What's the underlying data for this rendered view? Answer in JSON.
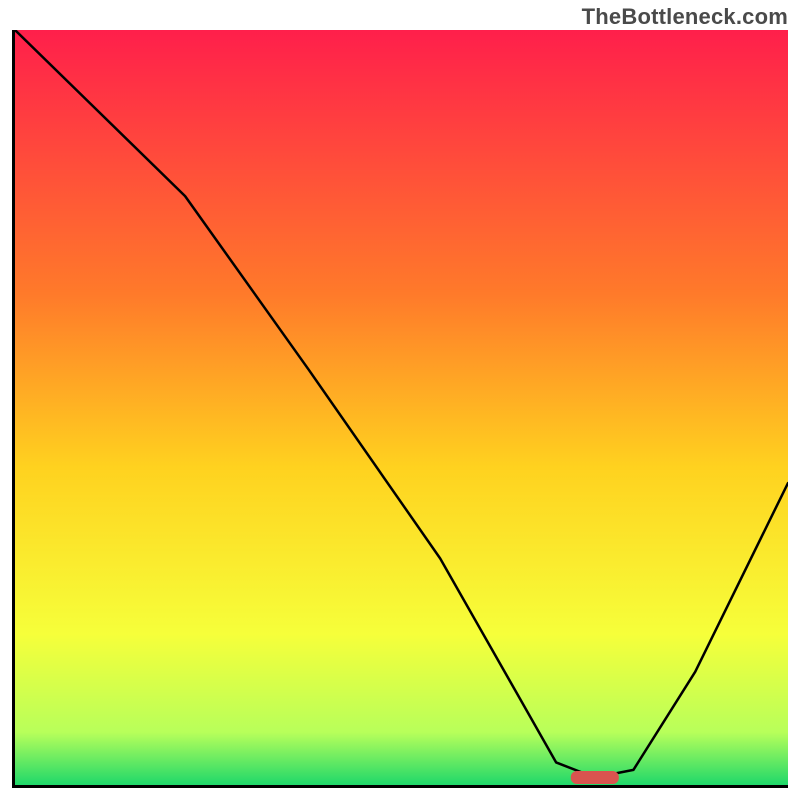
{
  "watermark": "TheBottleneck.com",
  "colors": {
    "top": "#ff1f4b",
    "upper_mid": "#ff7a2a",
    "mid": "#ffd21f",
    "lower_mid": "#f6ff3a",
    "near_bottom": "#b8ff5a",
    "bottom": "#1fd86a",
    "axis": "#000000",
    "curve": "#000000",
    "marker": "#d9544f"
  },
  "chart_data": {
    "type": "line",
    "title": "",
    "xlabel": "",
    "ylabel": "",
    "xlim": [
      0,
      100
    ],
    "ylim": [
      0,
      100
    ],
    "grid": false,
    "legend": false,
    "background": "red-yellow-green vertical gradient (red top, green bottom)",
    "series": [
      {
        "name": "bottleneck-curve",
        "x": [
          0,
          10,
          22,
          38,
          55,
          65,
          70,
          75,
          80,
          88,
          100
        ],
        "values": [
          100,
          90,
          78,
          55,
          30,
          12,
          3,
          1,
          2,
          15,
          40
        ]
      }
    ],
    "annotations": [
      {
        "type": "marker",
        "shape": "pill",
        "x": 75,
        "y": 1,
        "color": "#d9544f"
      }
    ]
  }
}
